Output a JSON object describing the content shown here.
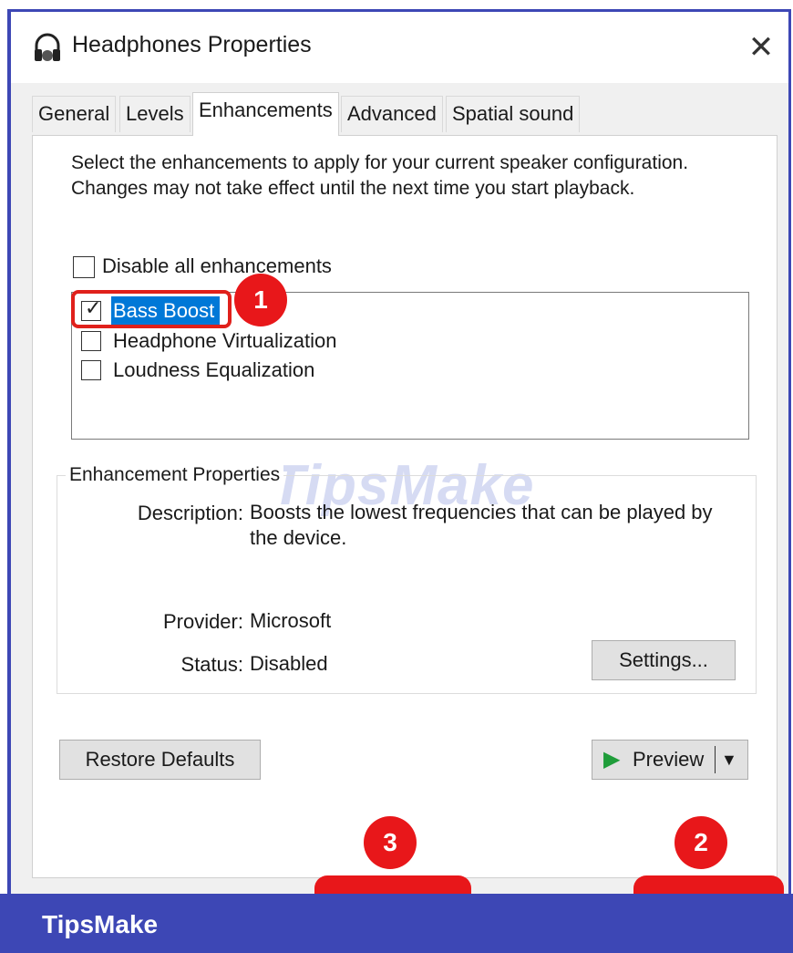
{
  "window": {
    "title": "Headphones Properties",
    "close_glyph": "✕",
    "icon": "headphones-icon"
  },
  "tabs": [
    {
      "label": "General"
    },
    {
      "label": "Levels"
    },
    {
      "label": "Enhancements",
      "active": true
    },
    {
      "label": "Advanced"
    },
    {
      "label": "Spatial sound"
    }
  ],
  "enhancements": {
    "intro": "Select the enhancements to apply for your current speaker configuration. Changes may not take effect until the next time you start playback.",
    "disable_all": {
      "label": "Disable all enhancements",
      "checked": false
    },
    "items": [
      {
        "label": "Bass Boost",
        "checked": true,
        "selected": true
      },
      {
        "label": "Headphone Virtualization",
        "checked": false
      },
      {
        "label": "Loudness Equalization",
        "checked": false
      }
    ]
  },
  "properties": {
    "group_title": "Enhancement Properties",
    "description_label": "Description:",
    "description_value": "Boosts the lowest frequencies that can be played by the device.",
    "provider_label": "Provider:",
    "provider_value": "Microsoft",
    "status_label": "Status:",
    "status_value": "Disabled",
    "settings_button": "Settings..."
  },
  "buttons": {
    "restore_defaults": "Restore Defaults",
    "preview": "Preview",
    "preview_arrow": "▶",
    "dropdown_arrow": "▼"
  },
  "annotations": {
    "step1": "1",
    "step2": "2",
    "step3": "3"
  },
  "branding": {
    "footer_text": "TipsMake",
    "watermark": "TipsMake"
  },
  "colors": {
    "frame": "#3d47b5",
    "selection": "#0078d7",
    "annotation_red": "#e8171a",
    "preview_green": "#1f9d3a"
  }
}
